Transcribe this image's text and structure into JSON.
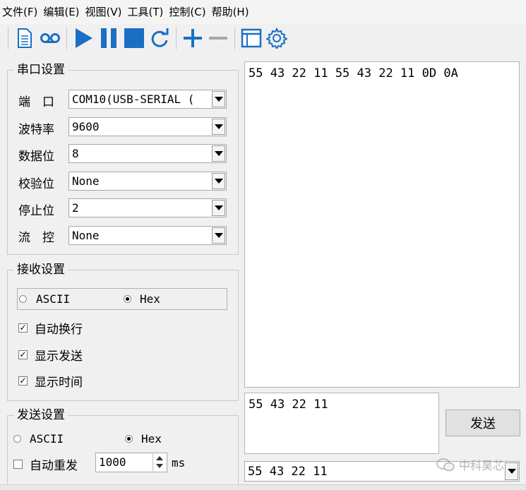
{
  "menu": [
    "文件(F)",
    "编辑(E)",
    "视图(V)",
    "工具(T)",
    "控制(C)",
    "帮助(H)"
  ],
  "serial": {
    "title": "串口设置",
    "port_label": "端　口",
    "port_value": "COM10(USB-SERIAL (",
    "baud_label": "波特率",
    "baud_value": "9600",
    "databits_label": "数据位",
    "databits_value": "8",
    "parity_label": "校验位",
    "parity_value": "None",
    "stopbits_label": "停止位",
    "stopbits_value": "2",
    "flow_label": "流　控",
    "flow_value": "None"
  },
  "receive": {
    "title": "接收设置",
    "ascii_label": "ASCII",
    "hex_label": "Hex",
    "auto_wrap_label": "自动换行",
    "show_send_label": "显示发送",
    "show_time_label": "显示时间"
  },
  "send": {
    "title": "发送设置",
    "ascii_label": "ASCII",
    "hex_label": "Hex",
    "auto_repeat_label": "自动重发",
    "interval_value": "1000",
    "unit": "ms",
    "button_label": "发送",
    "input_text": "55 43 22 11",
    "history_value": "55 43 22 11"
  },
  "receive_area_text": "55 43 22 11 55 43 22 11 0D 0A",
  "watermark": "中科昊芯",
  "colors": {
    "accent": "#1a6fc4"
  }
}
